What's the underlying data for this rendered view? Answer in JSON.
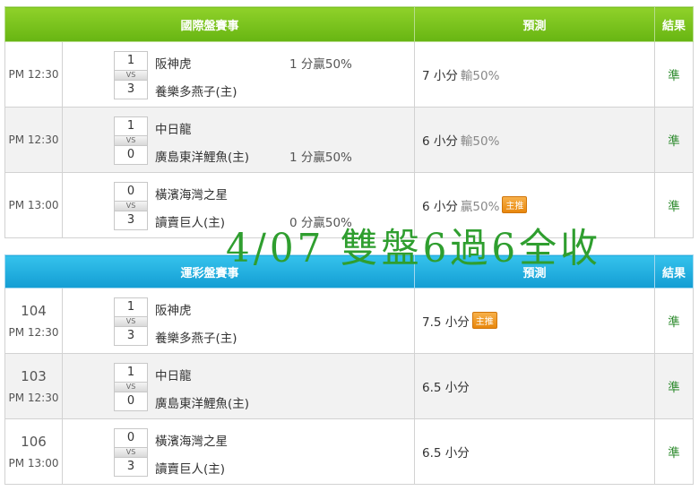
{
  "intl": {
    "headers": {
      "event": "國際盤賽事",
      "prediction": "預測",
      "result": "結果"
    },
    "rows": [
      {
        "time": "PM 12:30",
        "home_score": "1",
        "away_score": "3",
        "vs": "VS",
        "team1": "阪神虎",
        "team2": "養樂多燕子(主)",
        "odds": "1 分贏50%",
        "odds_row": 1,
        "pred_main": "7 小分",
        "pred_sub": "輸50%",
        "tag": "",
        "result": "準"
      },
      {
        "time": "PM 12:30",
        "home_score": "1",
        "away_score": "0",
        "vs": "VS",
        "team1": "中日龍",
        "team2": "廣島東洋鯉魚(主)",
        "odds": "1 分贏50%",
        "odds_row": 2,
        "pred_main": "6 小分",
        "pred_sub": "輸50%",
        "tag": "",
        "result": "準"
      },
      {
        "time": "PM 13:00",
        "home_score": "0",
        "away_score": "3",
        "vs": "VS",
        "team1": "橫濱海灣之星",
        "team2": "讀賣巨人(主)",
        "odds": "0 分贏50%",
        "odds_row": 2,
        "pred_main": "6 小分",
        "pred_sub": "贏50%",
        "tag": "主推",
        "result": "準"
      }
    ]
  },
  "lottery": {
    "headers": {
      "event": "運彩盤賽事",
      "prediction": "預測",
      "result": "結果"
    },
    "rows": [
      {
        "code": "104",
        "time": "PM 12:30",
        "home_score": "1",
        "away_score": "3",
        "vs": "VS",
        "team1": "阪神虎",
        "team2": "養樂多燕子(主)",
        "pred_main": "7.5 小分",
        "tag": "主推",
        "result": "準"
      },
      {
        "code": "103",
        "time": "PM 12:30",
        "home_score": "1",
        "away_score": "0",
        "vs": "VS",
        "team1": "中日龍",
        "team2": "廣島東洋鯉魚(主)",
        "pred_main": "6.5 小分",
        "tag": "",
        "result": "準"
      },
      {
        "code": "106",
        "time": "PM 13:00",
        "home_score": "0",
        "away_score": "3",
        "vs": "VS",
        "team1": "橫濱海灣之星",
        "team2": "讀賣巨人(主)",
        "pred_main": "6.5 小分",
        "tag": "",
        "result": "準"
      }
    ]
  },
  "banner": "4/07 雙盤6過6全收",
  "colors": {
    "intl_header": "#6fbe1a",
    "lottery_header": "#1aa7dc",
    "result_text": "#2e8b2e",
    "banner": "#2f9e2f",
    "tag": "#ee9a25"
  }
}
